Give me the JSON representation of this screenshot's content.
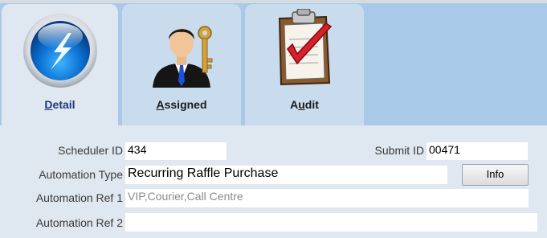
{
  "tabs": [
    {
      "label_ul": "D",
      "label_rest": "etail",
      "icon": "lightning-orb-icon",
      "selected": true
    },
    {
      "label_ul": "A",
      "label_rest": "ssigned",
      "icon": "person-key-icon",
      "selected": false
    },
    {
      "label_pre": "A",
      "label_ul": "u",
      "label_rest": "dit",
      "icon": "clipboard-check-icon",
      "selected": false
    }
  ],
  "form": {
    "scheduler_id_label": "Scheduler ID",
    "scheduler_id_value": "434",
    "submit_id_label": "Submit ID",
    "submit_id_value": "00471",
    "automation_type_label": "Automation Type",
    "automation_type_value": "Recurring Raffle Purchase",
    "info_button": "Info",
    "automation_ref1_label": "Automation Ref 1",
    "automation_ref1_value": "VIP,Courier,Call Centre",
    "automation_ref2_label": "Automation Ref 2",
    "automation_ref2_value": ""
  },
  "colors": {
    "background": "#a9c9e8",
    "panel": "#dfe7f0",
    "active_tab_label": "#1d3a7a"
  }
}
